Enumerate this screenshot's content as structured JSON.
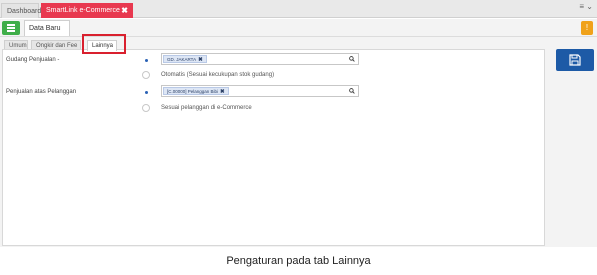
{
  "top_tabs": {
    "dashboard": "Dashboard",
    "smartlink": "SmartLink e-Commerce",
    "close": "✖",
    "menu": "≡ ⌄"
  },
  "doc_tab": {
    "label": "Data Baru",
    "close": "✖"
  },
  "form_tabs": {
    "umum": "Umum",
    "ongkir": "Ongkir dan Fee",
    "lainnya": "Lainnya"
  },
  "form": {
    "gudang_label": "Gudang Penjualan -",
    "gudang_value": "GD. JAKARTA",
    "otomatis_label": "Otomatis (Sesuai kecukupan stok gudang)",
    "pelanggan_label": "Penjualan atas Pelanggan",
    "pelanggan_value": "[C.00000] Pelanggan Bibi",
    "sesuai_label": "Sesuai pelanggan di e-Commerce"
  },
  "caption": "Pengaturan pada tab Lainnya",
  "icons": [
    "list-icon",
    "warning-icon",
    "search-icon",
    "save-icon",
    "close-icon"
  ],
  "colors": {
    "accent_tab": "#e8384f",
    "green": "#3fae49",
    "save": "#1d5aa6",
    "highlight": "#d9202e",
    "warning": "#f0a21a"
  }
}
